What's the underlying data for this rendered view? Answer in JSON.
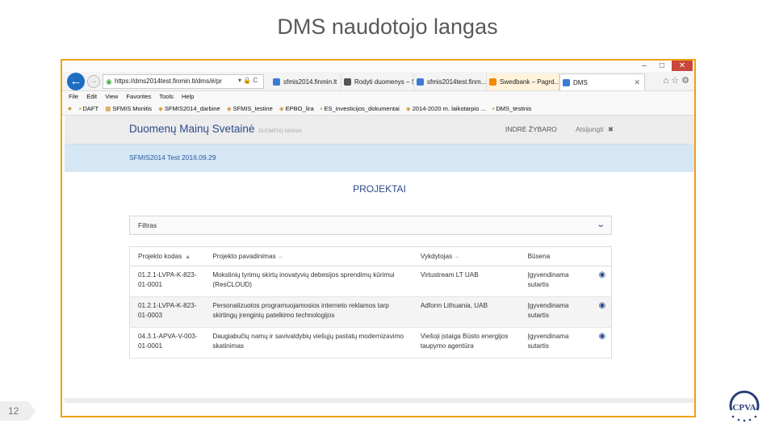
{
  "slide": {
    "title": "DMS naudotojo langas",
    "page_number": "12",
    "logo_text": "CPVA"
  },
  "browser": {
    "window_controls": [
      "–",
      "□",
      "✕"
    ],
    "address": "https://dms2014test.finmin.lt/dms/#/pr",
    "address_tools": "▾ 🔒 C",
    "tabs": [
      {
        "label": "sfmis2014.finmin.lt",
        "icon_color": "#3a7bd5"
      },
      {
        "label": "Rodyti duomenys – SF...",
        "icon_color": "#555555"
      },
      {
        "label": "sfmis2014test.finm...",
        "icon_color": "#3a7bd5"
      },
      {
        "label": "Swedbank – Pagrd...",
        "icon_color": "#f08a00"
      },
      {
        "label": "DMS",
        "icon_color": "#3a7bd5"
      }
    ],
    "menu": [
      "File",
      "Edit",
      "View",
      "Favorites",
      "Tools",
      "Help"
    ],
    "favorites": [
      "DAFT",
      "SFMIS Monitis",
      "SFMIS2014_darbine",
      "SFMIS_testine",
      "EPBO_lira",
      "ES_investicijos_dokumentai",
      "2014-2020 m. laikotarpio ...",
      "DMS_testinis"
    ]
  },
  "site": {
    "name": "Duomenų Mainų Svetainė",
    "subtitle": "DUOMENŲ MAINAI",
    "user": "INDRĖ ŽYBARO",
    "logout": "Atsijungti",
    "system_label": "SFMIS2014 Test 2016.09.29",
    "page_title": "PROJEKTAI",
    "filter_label": "Filtras",
    "columns": [
      "Projekto kodas",
      "Projekto pavadinimas",
      "Vykdytojas",
      "Būsena"
    ],
    "rows": [
      {
        "code": "01.2.1-LVPA-K-823-01-0001",
        "name": "Mokslinių tyrimų skirtų inovatyvių debesijos sprendimų kūrimui (ResCLOUD)",
        "executor": "Virtustream LT UAB",
        "status": "Įgyvendinama sutartis"
      },
      {
        "code": "01.2.1-LVPA-K-823-01-0003",
        "name": "Personalizuotos programuojamosios interneto reklamos tarp skirtingų įrenginių patelkimo technologijos",
        "executor": "Adform Lithuania, UAB",
        "status": "Įgyvendinama sutartis"
      },
      {
        "code": "04.3.1-APVA-V-003-01-0001",
        "name": "Daugiabučių namų ir savivaldybių viešųjų pastatų modernizavimo skatinimas",
        "executor": "Viešoji įstaiga Būsto energijos taupymo agentūra",
        "status": "Įgyvendinama sutartis"
      }
    ]
  }
}
